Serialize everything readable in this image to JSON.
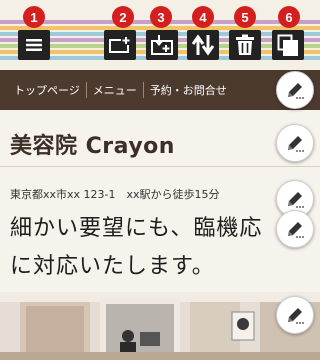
{
  "toolbar": {
    "badges": [
      "1",
      "2",
      "3",
      "4",
      "5",
      "6"
    ],
    "icons": [
      "hamburger-menu-icon",
      "add-section-icon",
      "insert-section-icon",
      "reorder-icon",
      "trash-icon",
      "copy-icon"
    ]
  },
  "nav": {
    "items": [
      "トップページ",
      "メニュー",
      "予約・お問合せ"
    ]
  },
  "page": {
    "title": "美容院 Crayon",
    "address": "東京都xx市xx 123-1　xx駅から徒歩15分",
    "catch_line1": "細かい要望にも、臨機応",
    "catch_line2": "に対応いたします。"
  },
  "colors": {
    "badge": "#d51f1f",
    "navbar": "#4d3a2e",
    "title": "#3b2f26"
  }
}
